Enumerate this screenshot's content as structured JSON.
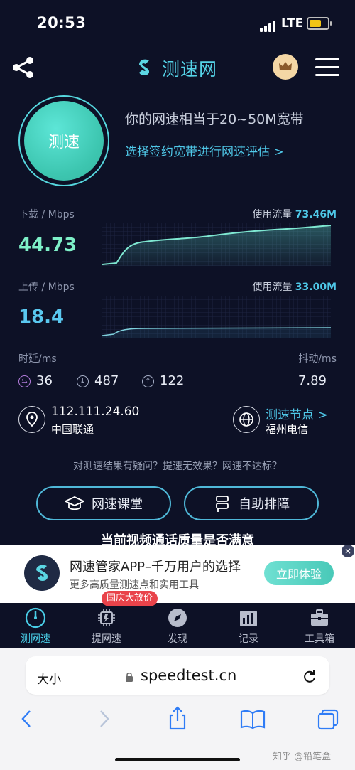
{
  "status_bar": {
    "time": "20:53",
    "network": "LTE"
  },
  "header": {
    "brand": "测速网",
    "share_icon": "share-icon",
    "vip_icon": "crown-icon",
    "menu_icon": "menu-icon"
  },
  "speedtest": {
    "button_label": "测速",
    "equivalent_text": "你的网速相当于20~50M宽带",
    "evaluate_link": "选择签约宽带进行网速评估 >"
  },
  "download": {
    "label": "下载 / Mbps",
    "value": "44.73",
    "traffic_label": "使用流量",
    "traffic_value": "73.46M",
    "color": "#7ef0c8"
  },
  "upload": {
    "label": "上传 / Mbps",
    "value": "18.4",
    "traffic_label": "使用流量",
    "traffic_value": "33.00M",
    "color": "#5ac8f0"
  },
  "latency": {
    "label": "时延/ms",
    "jitter_label": "抖动/ms",
    "ping": "36",
    "download_latency": "487",
    "upload_latency": "122",
    "jitter": "7.89"
  },
  "network": {
    "ip": "112.111.24.60",
    "isp": "中国联通",
    "node_link": "测速节点 >",
    "node_city": "福州电信"
  },
  "feedback_text": "对测速结果有疑问？提速无效果？网速不达标？",
  "actions": {
    "classroom": "网速课堂",
    "troubleshoot": "自助排障"
  },
  "partial_text": "当前视频通话质量是否满意",
  "ad": {
    "title": "网速管家APP–千万用户的选择",
    "subtitle": "更多高质量测速点和实用工具",
    "button": "立即体验",
    "close": "×"
  },
  "bottom_nav": {
    "promo_badge": "国庆大放价",
    "items": [
      {
        "label": "测网速",
        "icon": "speedometer-icon"
      },
      {
        "label": "提网速",
        "icon": "chip-icon"
      },
      {
        "label": "发现",
        "icon": "compass-icon"
      },
      {
        "label": "记录",
        "icon": "bar-chart-icon"
      },
      {
        "label": "工具箱",
        "icon": "toolbox-icon"
      }
    ]
  },
  "browser": {
    "text_size": "大小",
    "url": "speedtest.cn"
  },
  "watermark": "知乎 @铅笔盒",
  "colors": {
    "accent": "#4fc8e8",
    "background": "#0d1126",
    "ad_button": "#49c9b8",
    "promo": "#e9434a"
  }
}
